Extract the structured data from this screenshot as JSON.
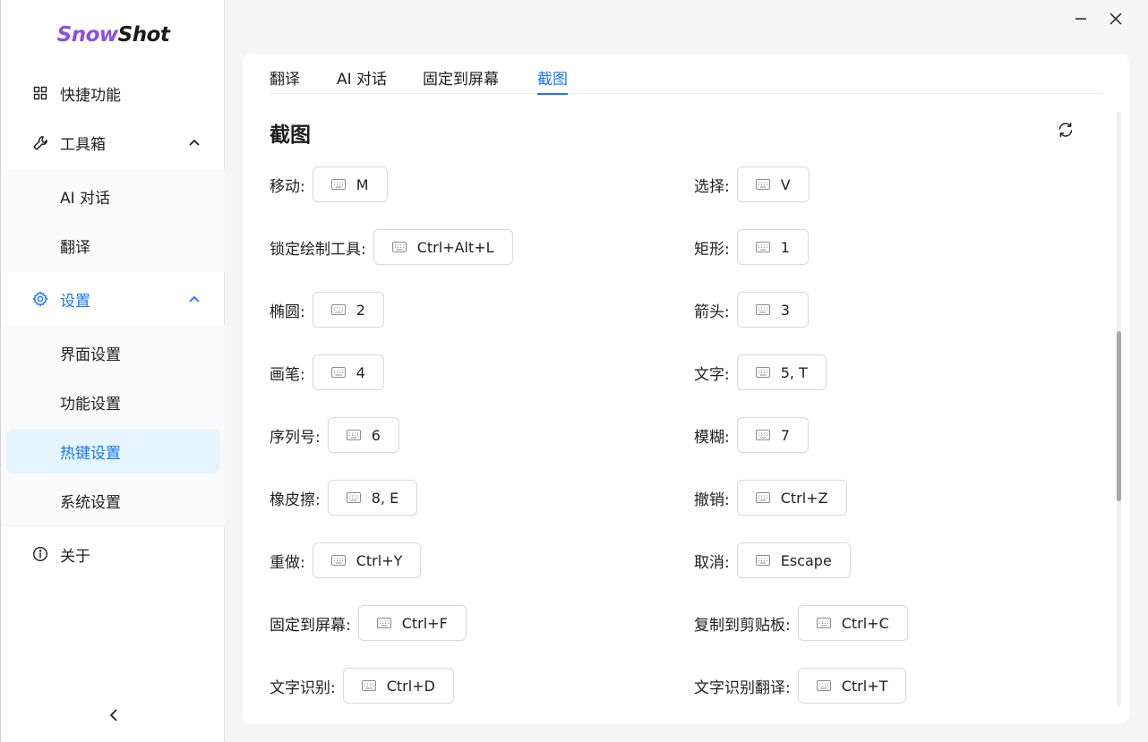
{
  "app": {
    "logo_part1": "Snow",
    "logo_part2": "Shot"
  },
  "sidebar": {
    "items": [
      {
        "label": "快捷功能",
        "icon": "grid-icon"
      },
      {
        "label": "工具箱",
        "icon": "wrench-icon",
        "expanded": true,
        "children": [
          {
            "label": "AI 对话"
          },
          {
            "label": "翻译"
          }
        ]
      },
      {
        "label": "设置",
        "icon": "gear-icon",
        "expanded": true,
        "children": [
          {
            "label": "界面设置"
          },
          {
            "label": "功能设置"
          },
          {
            "label": "热键设置",
            "active": true
          },
          {
            "label": "系统设置"
          }
        ]
      },
      {
        "label": "关于",
        "icon": "info-icon"
      }
    ]
  },
  "tabs": [
    {
      "label": "翻译"
    },
    {
      "label": "AI 对话"
    },
    {
      "label": "固定到屏幕"
    },
    {
      "label": "截图",
      "active": true
    }
  ],
  "section": {
    "title": "截图"
  },
  "hotkeys_left": [
    {
      "label": "移动",
      "key": "M"
    },
    {
      "label": "锁定绘制工具",
      "key": "Ctrl+Alt+L"
    },
    {
      "label": "椭圆",
      "key": "2"
    },
    {
      "label": "画笔",
      "key": "4"
    },
    {
      "label": "序列号",
      "key": "6"
    },
    {
      "label": "橡皮擦",
      "key": "8, E"
    },
    {
      "label": "重做",
      "key": "Ctrl+Y"
    },
    {
      "label": "固定到屏幕",
      "key": "Ctrl+F"
    },
    {
      "label": "文字识别",
      "key": "Ctrl+D"
    }
  ],
  "hotkeys_right": [
    {
      "label": "选择",
      "key": "V"
    },
    {
      "label": "矩形",
      "key": "1"
    },
    {
      "label": "箭头",
      "key": "3"
    },
    {
      "label": "文字",
      "key": "5, T"
    },
    {
      "label": "模糊",
      "key": "7"
    },
    {
      "label": "撤销",
      "key": "Ctrl+Z"
    },
    {
      "label": "取消",
      "key": "Escape"
    },
    {
      "label": "复制到剪贴板",
      "key": "Ctrl+C"
    },
    {
      "label": "文字识别翻译",
      "key": "Ctrl+T"
    }
  ],
  "label_suffix": ":",
  "colors": {
    "accent": "#1677ff",
    "logo_accent": "#8b4fe0",
    "active_bg": "#e6f4ff"
  }
}
